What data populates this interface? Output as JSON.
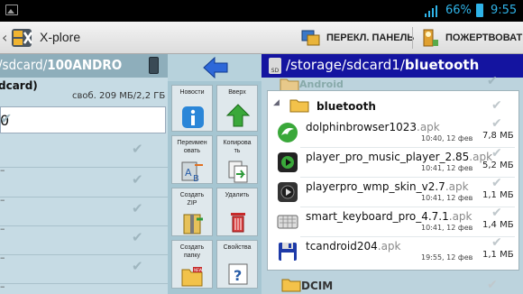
{
  "status_bar": {
    "battery_percent": "66%",
    "time": "9:55"
  },
  "action_bar": {
    "title": "X-plore",
    "switch_panel_label": "ПЕРЕКЛ. ПАНЕЛЬ",
    "donate_label": "ПОЖЕРТВОВАТЬ"
  },
  "left_panel": {
    "path_prefix": "/sdcard/",
    "path_bold": "100ANDRO",
    "row0_label": "dcard)",
    "free_space": "своб. 209 МБ/2,2 ГБ",
    "selected_label": "0"
  },
  "middle_panel": {
    "buttons": [
      {
        "label": "Новости",
        "icon": "info-icon"
      },
      {
        "label": "Вверх",
        "icon": "up-arrow-icon"
      },
      {
        "label": "Переимен\nовать",
        "icon": "rename-icon"
      },
      {
        "label": "Копирова\nть",
        "icon": "copy-icon"
      },
      {
        "label": "Создать\nZIP",
        "icon": "zip-icon"
      },
      {
        "label": "Удалить",
        "icon": "trash-icon"
      },
      {
        "label": "Создать\nпапку",
        "icon": "new-folder-icon"
      },
      {
        "label": "Свойства",
        "icon": "properties-icon"
      }
    ]
  },
  "right_panel": {
    "path_prefix": "/storage/sdcard1/",
    "path_bold": "bluetooth",
    "above_folder": "Android",
    "current_folder": "bluetooth",
    "files": [
      {
        "name": "dolphinbrowser1023",
        "ext": ".apk",
        "date": "10:40, 12 фев",
        "size": "7,8 МБ",
        "icon": "dolphin-app-icon"
      },
      {
        "name": "player_pro_music_player_2.85",
        "ext": ".apk",
        "date": "10:41, 12 фев",
        "size": "5,2 МБ",
        "icon": "player-app-icon"
      },
      {
        "name": "playerpro_wmp_skin_v2.7",
        "ext": ".apk",
        "date": "10:41, 12 фев",
        "size": "1,1 МБ",
        "icon": "player-skin-app-icon"
      },
      {
        "name": "smart_keyboard_pro_4.7.1",
        "ext": ".apk",
        "date": "10:41, 12 фев",
        "size": "1,4 МБ",
        "icon": "keyboard-app-icon"
      },
      {
        "name": "tcandroid204",
        "ext": ".apk",
        "date": "19:55, 12 фев",
        "size": "1,1 МБ",
        "icon": "floppy-app-icon"
      }
    ],
    "below_folder": "DCIM"
  },
  "colors": {
    "right_header": "#1414a0",
    "left_header": "#8eaebb",
    "status_accent": "#2fb3e8"
  }
}
